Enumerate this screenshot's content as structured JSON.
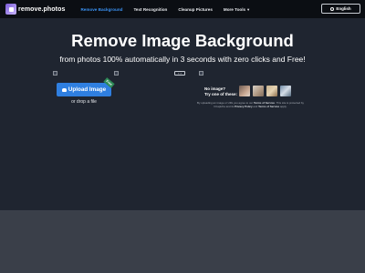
{
  "brand": {
    "name": "remove.photos"
  },
  "nav": {
    "items": [
      {
        "label": "Remove Background",
        "active": true
      },
      {
        "label": "Text Recognition",
        "active": false
      },
      {
        "label": "Cleanup Pictures",
        "active": false
      },
      {
        "label": "More Tools",
        "active": false,
        "has_dropdown": true
      }
    ]
  },
  "language": {
    "label": "English",
    "icon": "globe-icon"
  },
  "hero": {
    "title": "Remove Image Background",
    "subtitle": "from photos 100% automatically in 3 seconds with zero clicks and Free!"
  },
  "upload": {
    "button_label": "Upload Image",
    "badge": "Free",
    "drop_text": "or drop a file"
  },
  "samples": {
    "prompt_line1": "No image?",
    "prompt_line2": "Try one of these:"
  },
  "legal": {
    "pre": "By uploading an image or URL you agree to our ",
    "terms": "Terms of Service",
    "mid": ". This site is protected by hCaptcha and its ",
    "privacy": "Privacy Policy",
    "and": " and ",
    "terms2": "Terms of Service",
    "post": " apply."
  },
  "colors": {
    "accent": "#3b93f5",
    "button": "#2f7fe0",
    "background": "#1f2530",
    "navbar": "#0b0e13"
  }
}
